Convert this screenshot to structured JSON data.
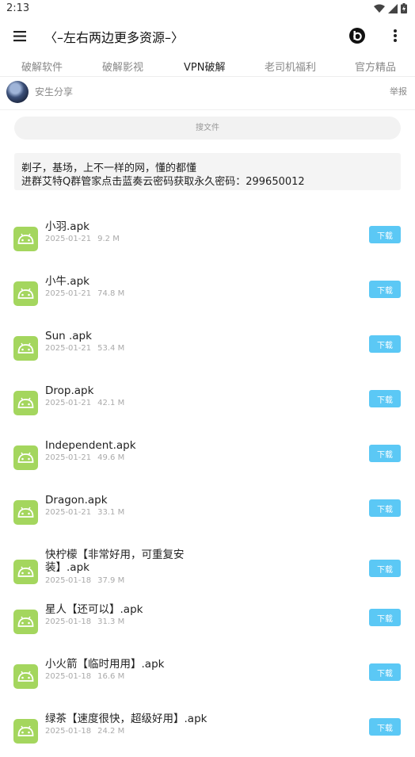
{
  "status_bar": {
    "time": "2:13"
  },
  "app_bar": {
    "title": "〈–左右两边更多资源–〉"
  },
  "tabs": [
    "破解软件",
    "破解影视",
    "VPN破解",
    "老司机福利",
    "官方精品"
  ],
  "active_tab": "VPN破解",
  "profile": {
    "name": "安生分享",
    "report": "举报"
  },
  "search": {
    "placeholder": "搜文件"
  },
  "notice": {
    "line1": "剃子，基场，上不一样的网，懂的都懂",
    "line2": "进群艾特Q群管家点击蓝奏云密码获取永久密码：299650012"
  },
  "download_label": "下载",
  "files": [
    {
      "name": "小羽.apk",
      "date": "2025-01-21",
      "size": "9.2 M"
    },
    {
      "name": "小牛.apk",
      "date": "2025-01-21",
      "size": "74.8 M"
    },
    {
      "name": "Sun .apk",
      "date": "2025-01-21",
      "size": "53.4 M"
    },
    {
      "name": "Drop.apk",
      "date": "2025-01-21",
      "size": "42.1 M"
    },
    {
      "name": "Independent.apk",
      "date": "2025-01-21",
      "size": "49.6 M"
    },
    {
      "name": "Dragon.apk",
      "date": "2025-01-21",
      "size": "33.1 M"
    },
    {
      "name": "快柠檬【非常好用，可重复安装】.apk",
      "date": "2025-01-18",
      "size": "37.9 M"
    },
    {
      "name": "星人【还可以】.apk",
      "date": "2025-01-18",
      "size": "31.3 M"
    },
    {
      "name": "小火箭【临时用用】.apk",
      "date": "2025-01-18",
      "size": "16.6 M"
    },
    {
      "name": "绿茶【速度很快，超级好用】.apk",
      "date": "2025-01-18",
      "size": "24.2 M"
    }
  ],
  "colors": {
    "accent": "#5bc8f5",
    "android_green": "#a4d65e"
  }
}
